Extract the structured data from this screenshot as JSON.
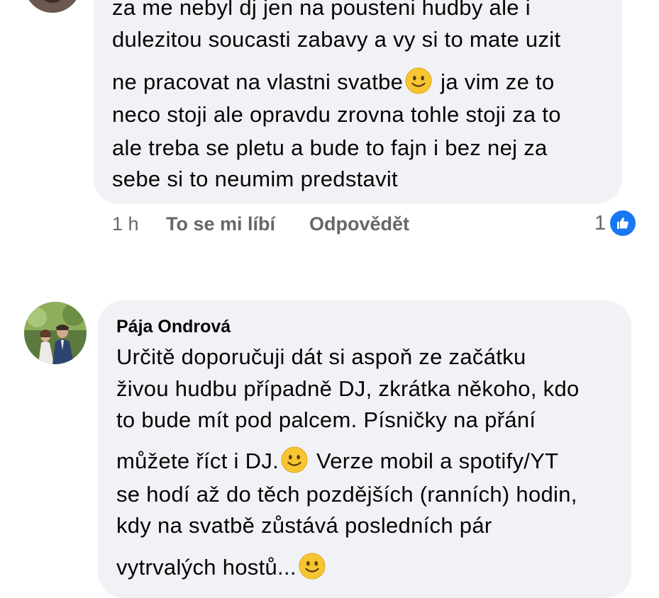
{
  "comments": [
    {
      "author": "",
      "lines": [
        "za me nebyl dj jen na pousteni hudby ale i",
        "dulezitou soucasti zabavy a vy si to mate uzit",
        "ne pracovat na vlastni svatbe",
        " ja vim ze to",
        "neco stoji ale opravdu zrovna tohle stoji za to",
        "ale treba se pletu a bude to fajn i bez nej za",
        "sebe si to neumim predstavit"
      ],
      "time": "1 h",
      "like_label": "To se mi líbí",
      "reply_label": "Odpovědět",
      "reaction_count": "1",
      "reaction_icon": "like-icon",
      "accent": "#1877f2"
    },
    {
      "author": "Pája Ondrová",
      "lines": [
        "Určitě doporučuji dát si aspoň ze začátku",
        "živou hudbu případně DJ, zkrátka někoho, kdo",
        "to bude mít pod palcem. Písničky na přání",
        "můžete říct i DJ.",
        " Verze mobil a spotify/YT",
        "se hodí až do těch pozdějších (ranních) hodin,",
        "kdy na svatbě zůstává posledních pár",
        "vytrvalých hostů..."
      ]
    }
  ]
}
